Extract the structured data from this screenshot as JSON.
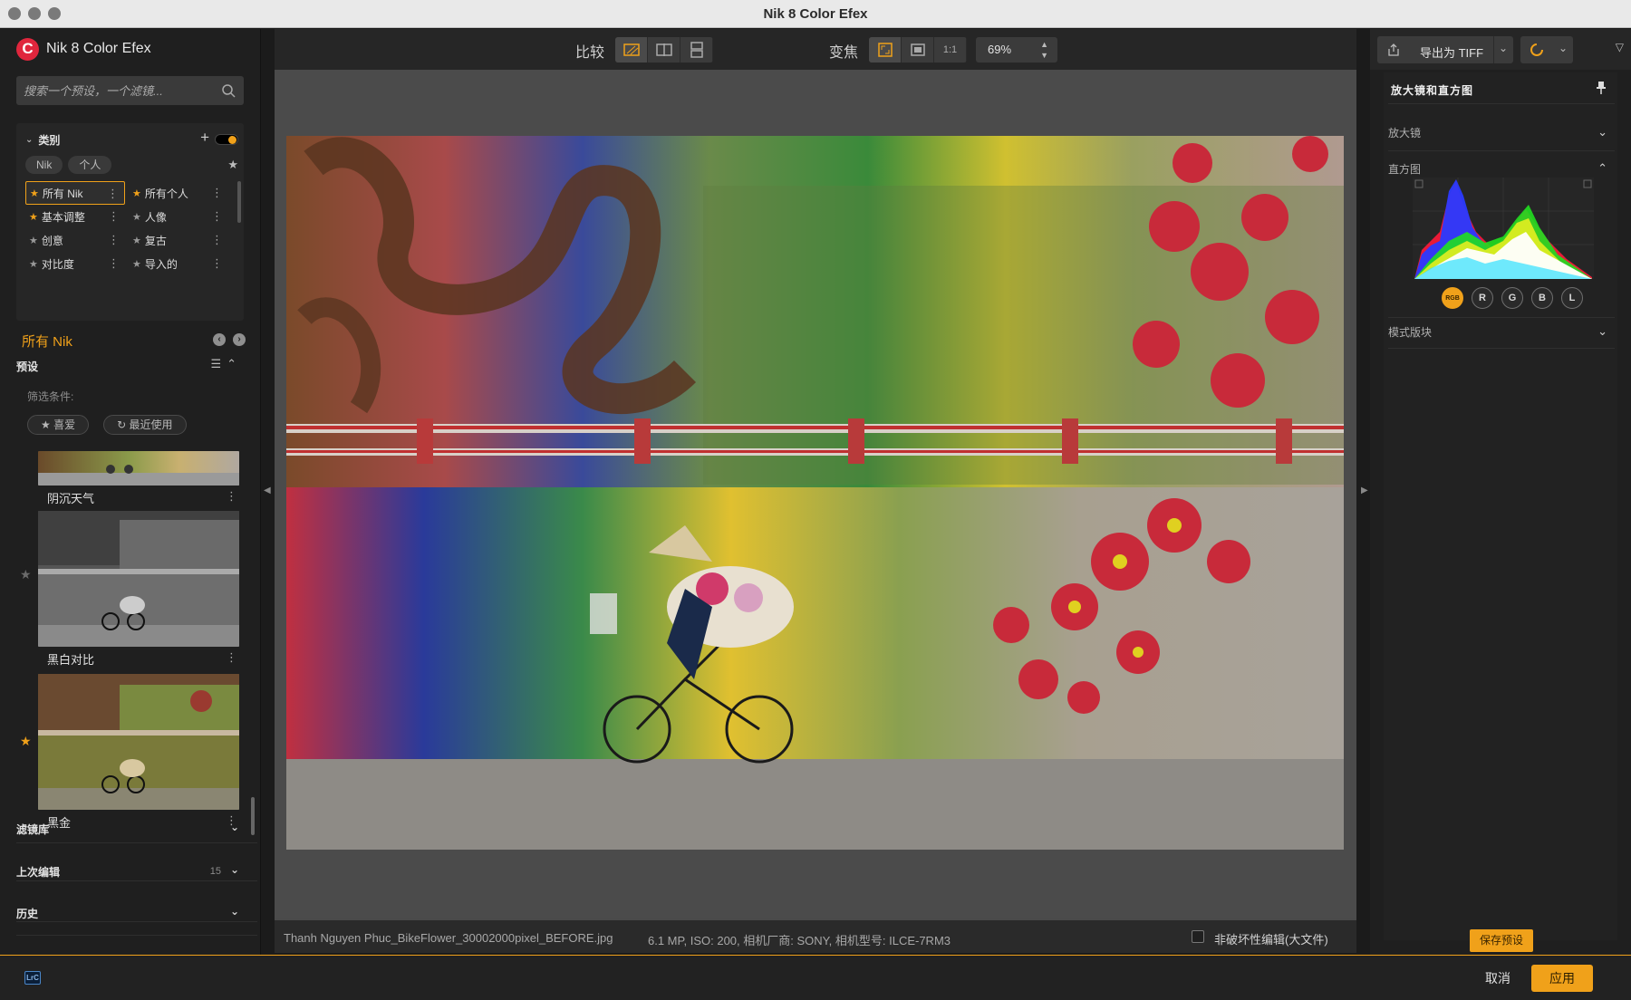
{
  "window": {
    "title": "Nik 8 Color Efex"
  },
  "app": {
    "logo_letter": "C",
    "name": "Nik 8 Color Efex"
  },
  "search": {
    "placeholder": "搜索一个预设，一个滤镜..."
  },
  "categories": {
    "header": "类别",
    "chips": [
      "Nik",
      "个人"
    ],
    "items": [
      {
        "label": "所有 Nik",
        "starred": true,
        "selected": true
      },
      {
        "label": "所有个人",
        "starred": true,
        "selected": false
      },
      {
        "label": "基本调整",
        "starred": true,
        "selected": false
      },
      {
        "label": "人像",
        "starred": false,
        "selected": false
      },
      {
        "label": "创意",
        "starred": false,
        "selected": false
      },
      {
        "label": "复古",
        "starred": false,
        "selected": false
      },
      {
        "label": "对比度",
        "starred": false,
        "selected": false
      },
      {
        "label": "导入的",
        "starred": false,
        "selected": false
      }
    ]
  },
  "current_category": "所有 Nik",
  "presets": {
    "header": "预设",
    "filter_label": "筛选条件:",
    "filters": [
      "喜爱",
      "最近使用"
    ],
    "items": [
      {
        "label": "阴沉天气",
        "favorite": false
      },
      {
        "label": "黑白对比",
        "favorite": false
      },
      {
        "label": "黑金",
        "favorite": true
      }
    ]
  },
  "sections": {
    "filter_library": "滤镜库",
    "last_edit": "上次编辑",
    "last_edit_count": "15",
    "history": "历史"
  },
  "toolbar": {
    "compare_label": "比较",
    "zoom_label": "变焦",
    "one_to_one": "1:1",
    "zoom_value": "69%"
  },
  "status": {
    "filename": "Thanh Nguyen Phuc_BikeFlower_30002000pixel_BEFORE.jpg",
    "meta": "6.1 MP, ISO: 200, 相机厂商: SONY, 相机型号: ILCE-7RM3",
    "nondestructive": "非破坏性编辑(大文件)"
  },
  "export": {
    "label": "导出为 TIFF"
  },
  "right_panel": {
    "header": "放大镜和直方图",
    "loupe": "放大镜",
    "histogram": "直方图",
    "channels": [
      "RGB",
      "R",
      "G",
      "B",
      "L"
    ],
    "active_channel": "RGB",
    "mode_blocks": "模式版块",
    "save_preset": "保存预设"
  },
  "bottom": {
    "lrc_badge": "LrC",
    "cancel": "取消",
    "apply": "应用"
  },
  "colors": {
    "accent": "#f0a11a",
    "brand_red": "#e0263d"
  }
}
